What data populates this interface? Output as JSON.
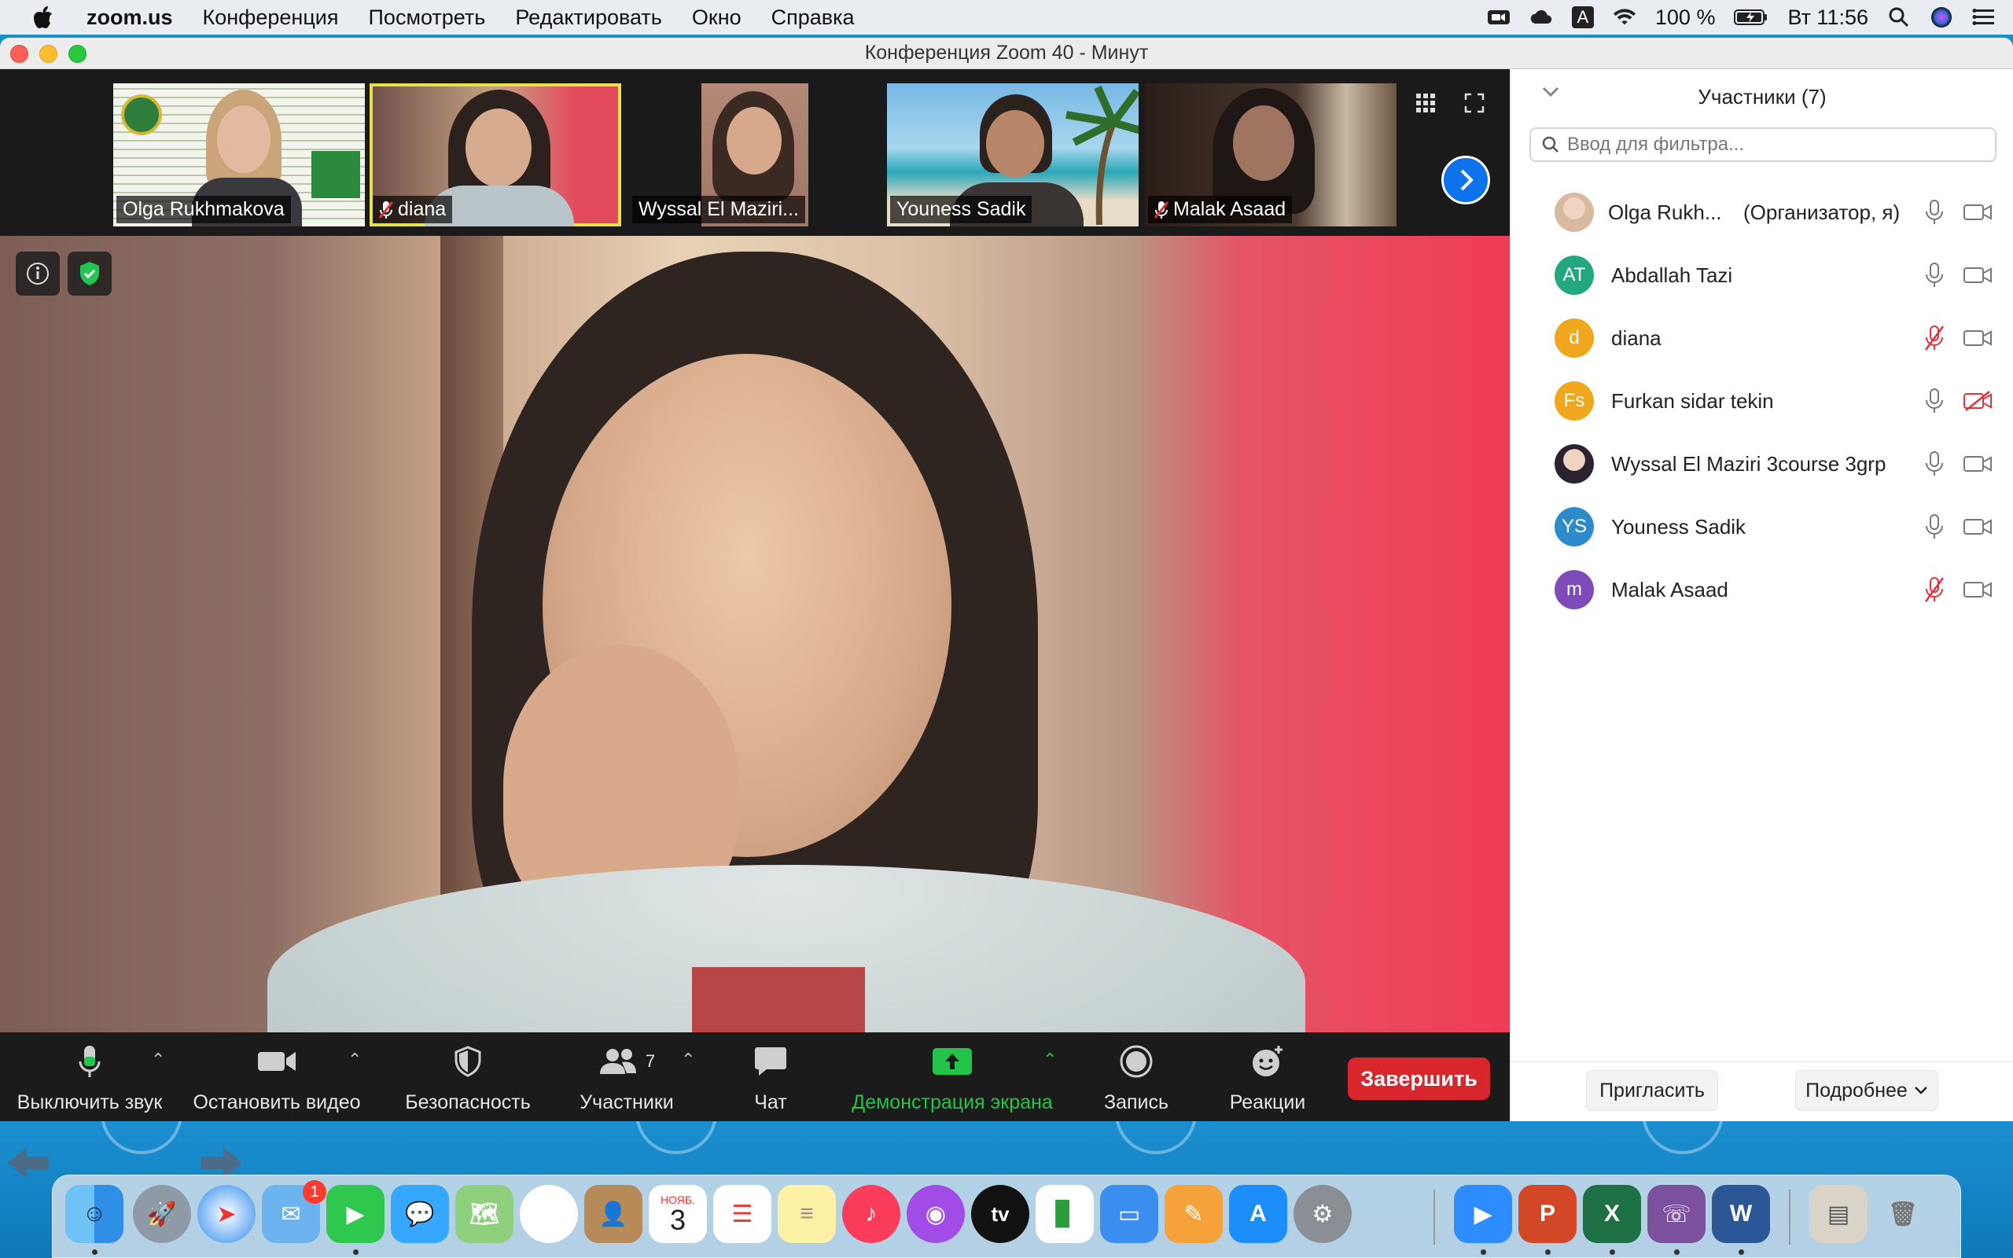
{
  "menubar": {
    "app": "zoom.us",
    "items": [
      "Конференция",
      "Посмотреть",
      "Редактировать",
      "Окно",
      "Справка"
    ],
    "battery": "100 %",
    "clock": "Вт 11:56",
    "input_lang": "A"
  },
  "window": {
    "title": "Конференция Zoom   40 - Минут"
  },
  "gallery": {
    "tiles": [
      {
        "name": "Olga Rukhmakova",
        "muted": false
      },
      {
        "name": "diana",
        "muted": true
      },
      {
        "name": "Wyssal El Maziri...",
        "muted": false
      },
      {
        "name": "Youness Sadik",
        "muted": false
      },
      {
        "name": "Malak Asaad",
        "muted": true
      }
    ]
  },
  "toolbar": {
    "mute": "Выключить звук",
    "video": "Остановить видео",
    "security": "Безопасность",
    "participants": "Участники",
    "participants_count": "7",
    "chat": "Чат",
    "share": "Демонстрация экрана",
    "record": "Запись",
    "reactions": "Реакции",
    "end": "Завершить"
  },
  "panel": {
    "title": "Участники (7)",
    "filter_placeholder": "Ввод для фильтра...",
    "participants": [
      {
        "name": "Olga Rukh...",
        "role": "(Организатор, я)",
        "initials": "",
        "color": "#d9b9a0",
        "mic_muted": false,
        "cam_off": false
      },
      {
        "name": "Abdallah Tazi",
        "role": "",
        "initials": "AT",
        "color": "#23a77f",
        "mic_muted": false,
        "cam_off": false
      },
      {
        "name": "diana",
        "role": "",
        "initials": "d",
        "color": "#f0a71d",
        "mic_muted": true,
        "cam_off": false
      },
      {
        "name": "Furkan sidar tekin",
        "role": "",
        "initials": "Fs",
        "color": "#f0a71d",
        "mic_muted": false,
        "cam_off": true
      },
      {
        "name": "Wyssal El Maziri 3course 3grp",
        "role": "",
        "initials": "",
        "color": "#2b2330",
        "mic_muted": false,
        "cam_off": false
      },
      {
        "name": "Youness Sadik",
        "role": "",
        "initials": "YS",
        "color": "#2d8bcb",
        "mic_muted": false,
        "cam_off": false
      },
      {
        "name": "Malak Asaad",
        "role": "",
        "initials": "m",
        "color": "#7e4bb8",
        "mic_muted": true,
        "cam_off": false
      }
    ],
    "invite": "Пригласить",
    "more": "Подробнее"
  },
  "dock": {
    "calendar_month": "НОЯБ.",
    "calendar_day": "3",
    "mail_badge": "1",
    "tv_label": "tv"
  },
  "colors": {
    "accent_blue": "#0e72ed",
    "end_red": "#d9262c",
    "share_green": "#24c448",
    "muted_red": "#e0323b"
  }
}
